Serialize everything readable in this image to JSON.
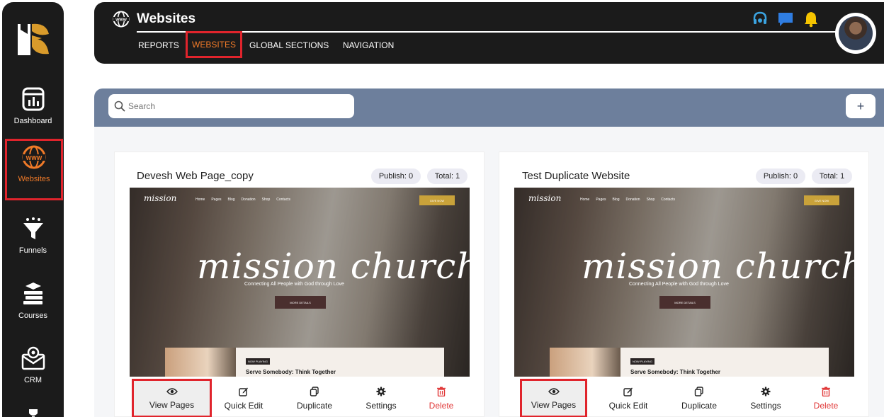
{
  "sidebar": {
    "items": [
      {
        "label": "Dashboard",
        "icon": "dashboard-icon"
      },
      {
        "label": "Websites",
        "icon": "www-globe-icon",
        "active": true
      },
      {
        "label": "Funnels",
        "icon": "funnel-icon"
      },
      {
        "label": "Courses",
        "icon": "books-icon"
      },
      {
        "label": "CRM",
        "icon": "crm-envelope-icon"
      }
    ]
  },
  "header": {
    "title": "Websites",
    "tabs": [
      {
        "label": "REPORTS"
      },
      {
        "label": "WEBSITES",
        "active": true
      },
      {
        "label": "GLOBAL SECTIONS"
      },
      {
        "label": "NAVIGATION"
      }
    ],
    "icons": [
      "headset-icon",
      "chat-icon",
      "bell-icon"
    ]
  },
  "search": {
    "placeholder": "Search",
    "add_label": "+"
  },
  "cards": [
    {
      "title": "Devesh Web Page_copy",
      "publish": "Publish: 0",
      "total": "Total: 1"
    },
    {
      "title": "Test Duplicate Website",
      "publish": "Publish: 0",
      "total": "Total: 1"
    }
  ],
  "thumbnail": {
    "logo": "mission",
    "nav": [
      "Home",
      "Pages",
      "Blog",
      "Donation",
      "Shop",
      "Contacts"
    ],
    "give_button": "GIVE NOW",
    "headline": "mission church",
    "tagline": "Connecting All People with God through Love",
    "more_button": "MORE DETAILS",
    "now_playing": "NOW PLAYING",
    "sermon": "Serve Somebody: Think Together"
  },
  "card_actions": {
    "view": "View Pages",
    "quick_edit": "Quick Edit",
    "duplicate": "Duplicate",
    "settings": "Settings",
    "delete": "Delete"
  },
  "colors": {
    "accent": "#f07a28",
    "highlight": "#e0242c",
    "band": "#6d7f9c",
    "dark": "#1b1b1b",
    "delete": "#e03535"
  }
}
